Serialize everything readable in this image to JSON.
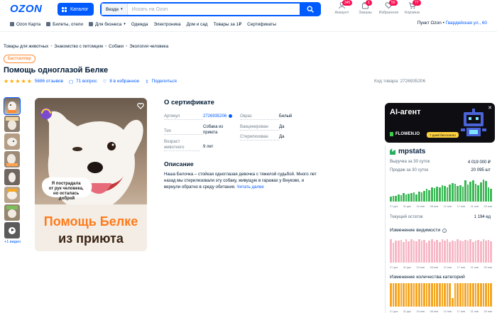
{
  "header": {
    "logo": "OZON",
    "catalog_label": "Каталог",
    "search_scope": "Везде",
    "search_placeholder": "Искать на Ozon",
    "icons": [
      {
        "label": "Аккаунт",
        "badge": "345"
      },
      {
        "label": "Заказы",
        "badge": "1"
      },
      {
        "label": "Избранное",
        "badge": "50"
      },
      {
        "label": "Корзина",
        "badge": "77"
      }
    ]
  },
  "subnav": {
    "items": [
      "Ozon Карта",
      "Билеты, отели",
      "Для бизнеса",
      "Одежда",
      "Электроника",
      "Дом и сад",
      "Товары за 1₽",
      "Сертификаты"
    ],
    "pickup_prefix": "Пункт Ozon •",
    "pickup_address": "Гвардейская ул., 60"
  },
  "breadcrumbs": [
    "Товары для животных",
    "Знакомство с питомцем",
    "Собаки",
    "Экология человека"
  ],
  "product": {
    "badge": "Бестселлер",
    "title": "Помощь одноглазой Белке",
    "reviews": "5686 отзывов",
    "questions": "71 вопрос",
    "favorites": "8 в избранное",
    "share": "Поделиться",
    "sku": "Код товара: 2726935206",
    "video_link": "+1 видео",
    "image_caption_top": "Я пострадала от рук человека, но осталась доброй",
    "image_caption_main_1": "Помощь Белке",
    "image_caption_main_2": "из приюта"
  },
  "certificate": {
    "title": "О сертификате",
    "specs_left": [
      {
        "k": "Артикул",
        "v": "2726935206"
      },
      {
        "k": "Тип",
        "v": "Собака из приюта"
      },
      {
        "k": "Возраст животного",
        "v": "9 лет"
      }
    ],
    "specs_right": [
      {
        "k": "Окрас",
        "v": "Белый"
      },
      {
        "k": "Вакцинирован",
        "v": "Да"
      },
      {
        "k": "Стерилизован",
        "v": "Да"
      }
    ],
    "desc_title": "Описание",
    "desc_text": "Наша Белочка – стойкая одноглазая девочка с тяжелой судьбой. Много лет назад мы стерилизовали эту собаку, живущую в гаражах у Внуково, и вернули обратно в среду обитания.",
    "desc_more": "Читать далее"
  },
  "ai_banner": {
    "title": "AI-агент",
    "brand": "FLOWEN.IO",
    "trial": "7 дней бесплатно"
  },
  "mpstats": {
    "brand": "mpstats",
    "revenue_label": "Выручка за 30 суток",
    "revenue_value": "4 019 000 ₽",
    "sales_label": "Продаж за 30 суток",
    "sales_value": "20 095 шт",
    "stock_label": "Текущий остаток",
    "stock_value": "1 194 ед",
    "visibility_label": "Изменение видимости",
    "categories_label": "Изменение количества категорий",
    "axis_dates": [
      "27 дек",
      "31 дек",
      "04 янв",
      "08 янв",
      "12 янв",
      "17 янв",
      "21 янв",
      "25 янв"
    ],
    "colors": {
      "green": "#3cb856",
      "pink": "#f6b8c6",
      "orange": "#f5a623"
    },
    "sales_chart": [
      0.22,
      0.25,
      0.24,
      0.3,
      0.28,
      0.35,
      0.3,
      0.32,
      0.35,
      0.38,
      0.3,
      0.42,
      0.4,
      0.45,
      0.55,
      0.5,
      0.6,
      0.58,
      0.65,
      0.6,
      0.7,
      0.66,
      0.62,
      0.72,
      0.8,
      0.75,
      0.68,
      0.7,
      0.65,
      0.92,
      0.72,
      0.85,
      0.9,
      0.75,
      0.7,
      0.82,
      0.95,
      0.88,
      0.62,
      0.55
    ],
    "visibility_chart": [
      0.95,
      0.8,
      0.9,
      0.88,
      0.92,
      0.82,
      0.93,
      0.86,
      0.95,
      0.9,
      0.85,
      0.94,
      0.88,
      0.92,
      0.8,
      0.9,
      0.95,
      0.87,
      0.91,
      0.84,
      0.93,
      0.88,
      0.95,
      0.82,
      0.9,
      0.86,
      0.94,
      0.9,
      0.85,
      0.92,
      0.88,
      0.95,
      0.83,
      0.9,
      0.92,
      0.86,
      0.94,
      0.89,
      0.91,
      0.87
    ],
    "categories_chart": [
      1,
      1,
      1,
      1,
      1,
      1,
      1,
      1,
      1,
      1,
      1,
      1,
      1,
      1,
      1,
      1,
      1,
      1,
      1,
      1,
      1,
      1,
      1,
      1,
      0.35,
      1,
      1,
      1,
      1,
      1,
      1,
      1,
      1,
      1,
      1,
      1,
      1,
      1,
      1,
      1
    ]
  }
}
